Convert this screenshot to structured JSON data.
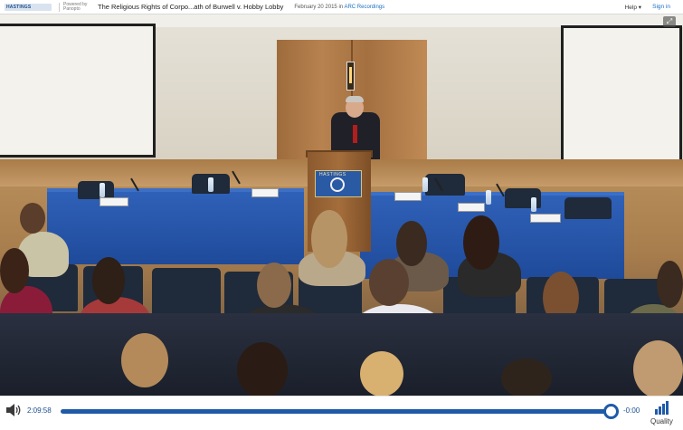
{
  "header": {
    "logo_text": "HASTINGS",
    "powered_by": "Powered by Panopto",
    "title": "The Religious Rights of Corpo...ath of Burwell v. Hobby Lobby",
    "date": "February 20 2015",
    "date_in": "in",
    "folder": "ARC Recordings",
    "help_label": "Help ▾",
    "signin_label": "Sign in"
  },
  "video": {
    "seal_text": "HASTINGS"
  },
  "controls": {
    "elapsed": "2:09:58",
    "remaining": "-0:00",
    "quality_label": "Quality",
    "progress": 1.0
  },
  "colors": {
    "accent": "#1f5aa8",
    "link": "#1a6fc2"
  },
  "icons": {
    "volume": "speaker-icon",
    "quality": "signal-bars-icon",
    "fullscreen": "fullscreen-icon"
  }
}
